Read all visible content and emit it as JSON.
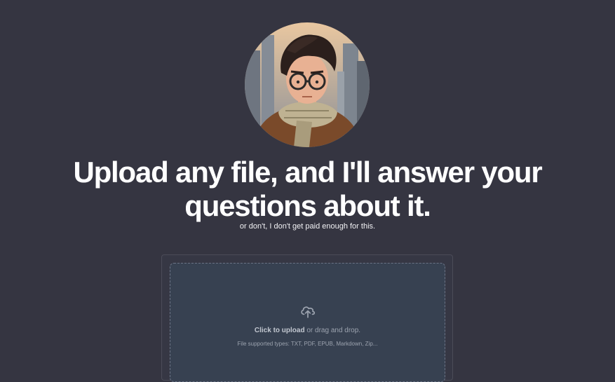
{
  "hero": {
    "avatar_icon": "person-portrait-avatar",
    "headline_line1": "Upload any file, and I'll answer your",
    "headline_line2": "questions about it.",
    "subtitle": "or don't, I don't get paid enough for this."
  },
  "uploader": {
    "icon": "cloud-upload-icon",
    "click_label": "Click to upload",
    "drag_label": " or drag and drop.",
    "supported_types": "File supported types: TXT, PDF, EPUB, Markdown, Zip..."
  },
  "colors": {
    "background": "#353541",
    "dropzone_bg": "#374151",
    "dropzone_border": "#6b7385",
    "muted_text": "#9ca3af"
  }
}
